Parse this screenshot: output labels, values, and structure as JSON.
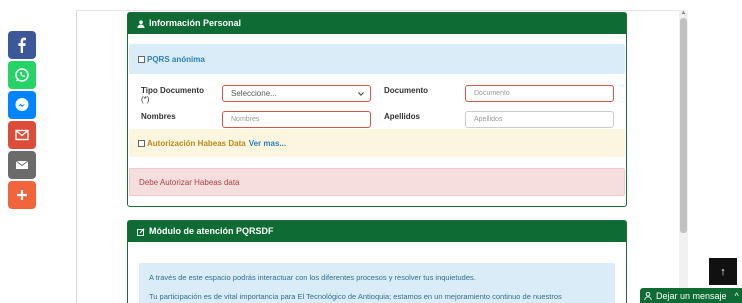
{
  "social": [
    {
      "name": "facebook",
      "color": "#3b5998"
    },
    {
      "name": "whatsapp",
      "color": "#25d366"
    },
    {
      "name": "messenger",
      "color": "#0084ff"
    },
    {
      "name": "gmail",
      "color": "#dd4b39"
    },
    {
      "name": "email",
      "color": "#6b6b6b"
    },
    {
      "name": "more",
      "color": "#f2643c"
    }
  ],
  "personal": {
    "title": "Información Personal",
    "anon_label": "PQRS anónima",
    "doc_type_label": "Tipo Documento",
    "doc_type_req": "(*)",
    "doc_type_value": "Seleccione...",
    "document_label": "Documento",
    "document_placeholder": "Documento",
    "names_label": "Nombres",
    "names_placeholder": "Nombres",
    "surnames_label": "Apellidos",
    "surnames_placeholder": "Apellidos",
    "habeas_label": "Autorización Habeas Data",
    "habeas_link": "Ver mas...",
    "habeas_error": "Debe Autorizar Habeas data"
  },
  "module": {
    "title": "Módulo de atención PQRSDF",
    "line1": "A través de este espacio podrás interactuar con los diferentes procesos y resolver tus inquietudes.",
    "line2": "Tu participación es de vital importancia para El Tecnológico de Antioquia; estamos en un mejoramiento continuo de nuestros"
  },
  "widgets": {
    "to_top": "↑",
    "chat_label": "Dejar un mensaje",
    "chat_chevron": "^"
  },
  "colors": {
    "header_green": "#0f6b34",
    "info_bg": "#d9ecf7",
    "warn_text": "#b88a18",
    "link_blue": "#2a80b9",
    "error_text": "#a94442"
  }
}
